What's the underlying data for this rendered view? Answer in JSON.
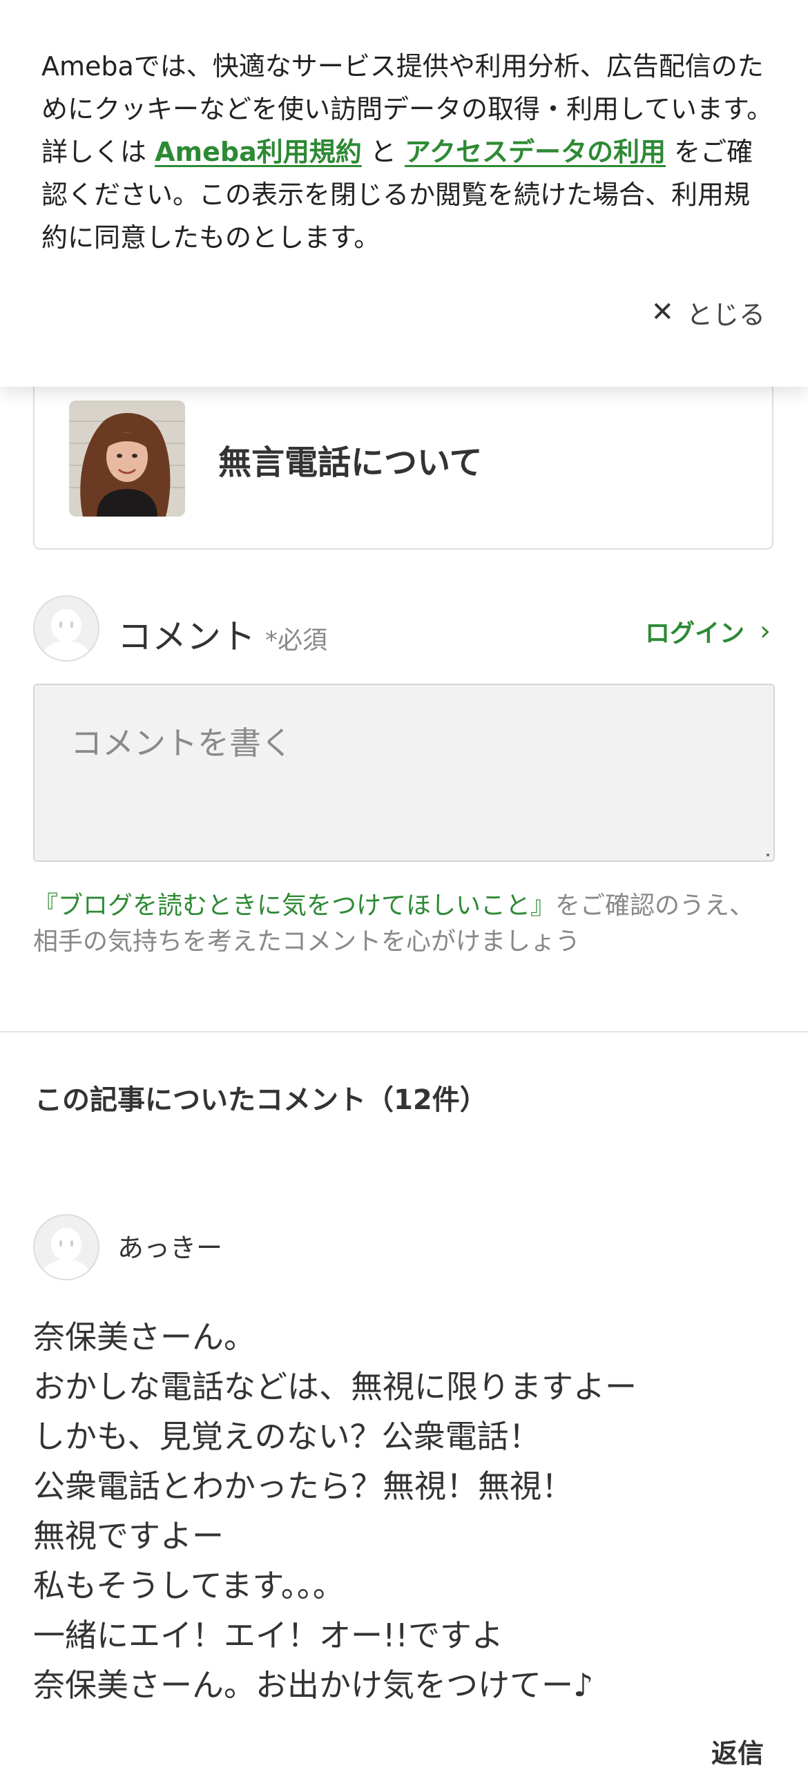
{
  "cookie_banner": {
    "text_part1": "Amebaでは、快適なサービス提供や利用分析、広告配信のためにクッキーなどを使い訪問データの取得・利用しています。詳しくは",
    "link_terms": "Ameba利用規約",
    "text_connector": "と",
    "link_access_data": "アクセスデータの利用",
    "text_part2": "をご確認ください。この表示を閉じるか閲覧を続けた場合、利用規約に同意したものとします。",
    "close_label": "とじる"
  },
  "entry": {
    "title": "無言電話について"
  },
  "comment_form": {
    "label": "コメント",
    "required": "*必須",
    "login_label": "ログイン",
    "placeholder": "コメントを書く",
    "guideline_link": "『ブログを読むときに気をつけてほしいこと』",
    "guideline_text": "をご確認のうえ、相手の気持ちを考えたコメントを心がけましょう"
  },
  "comments": {
    "heading": "この記事についたコメント（12件）",
    "items": [
      {
        "author": "あっきー",
        "lines": [
          "奈保美さーん。",
          "おかしな電話などは、無視に限りますよー",
          "しかも、見覚えのない？公衆電話！",
          "公衆電話とわかったら？無視！無視！",
          "無視ですよー",
          "私もそうしてます。。。",
          "一緒にエイ！エイ！オー!!ですよ",
          "奈保美さーん。お出かけ気をつけてー♪"
        ],
        "reply_label": "返信"
      }
    ]
  },
  "colors": {
    "accent_green": "#2d8a34",
    "text": "#333333",
    "muted": "#888888"
  },
  "icons": [
    "close-icon",
    "chevron-right-icon",
    "default-avatar-icon"
  ]
}
